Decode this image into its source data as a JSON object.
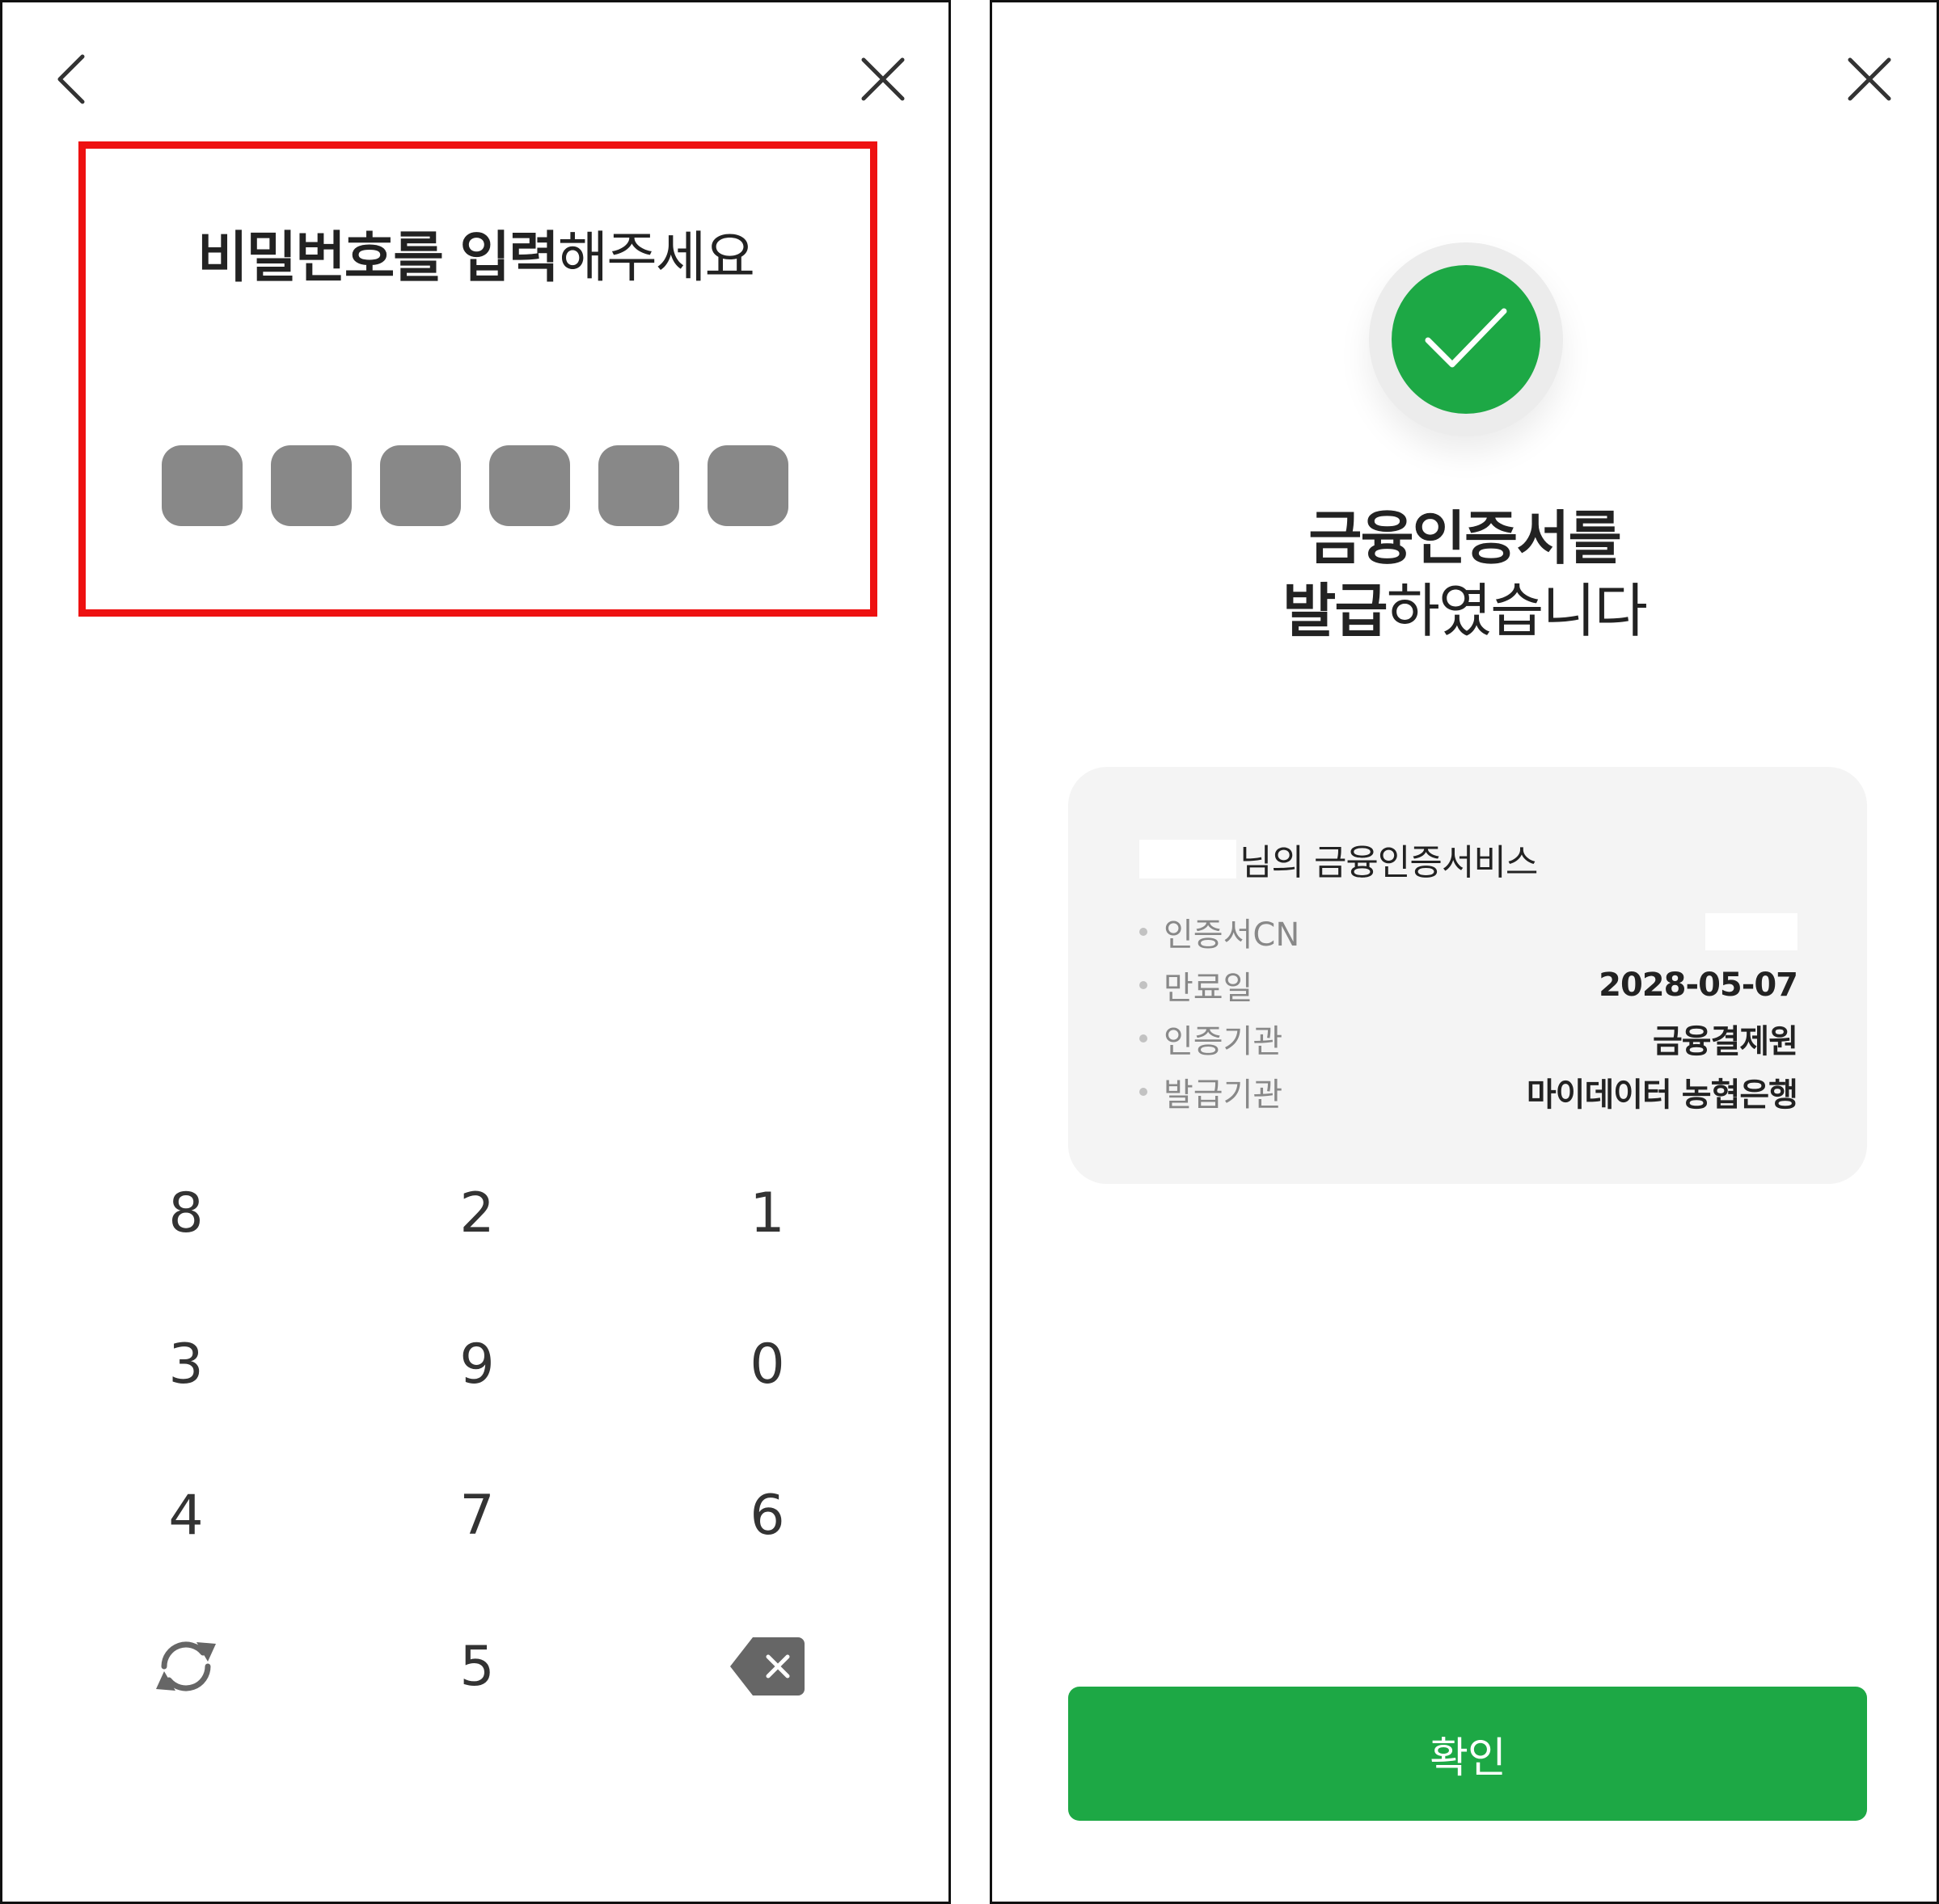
{
  "left_panel": {
    "title_strong": "비밀번호를 입력",
    "title_regular": "해주세요",
    "pin_length": 6,
    "keypad_rows": [
      [
        "8",
        "2",
        "1"
      ],
      [
        "3",
        "9",
        "0"
      ],
      [
        "4",
        "7",
        "6"
      ]
    ],
    "keypad_bottom_center": "5",
    "icons": {
      "back": "chevron-left-icon",
      "close": "close-icon",
      "shuffle": "refresh-icon",
      "delete": "backspace-icon"
    },
    "colors": {
      "highlight": "#ee1111",
      "pin_dot": "#888888"
    }
  },
  "right_panel": {
    "title_line1": "금융인증서를",
    "title_line2_strong": "발급",
    "title_line2_regular": "하였습니다",
    "card": {
      "service_suffix": "님의 금융인증서비스",
      "rows": [
        {
          "label": "인증서CN",
          "value": ""
        },
        {
          "label": "만료일",
          "value": "2028-05-07"
        },
        {
          "label": "인증기관",
          "value": "금융결제원"
        },
        {
          "label": "발급기관",
          "value": "마이데이터 농협은행"
        }
      ]
    },
    "confirm_label": "확인",
    "icons": {
      "close": "close-icon",
      "success": "check-icon"
    },
    "colors": {
      "accent": "#1da845",
      "card_bg": "#f4f4f4"
    }
  }
}
